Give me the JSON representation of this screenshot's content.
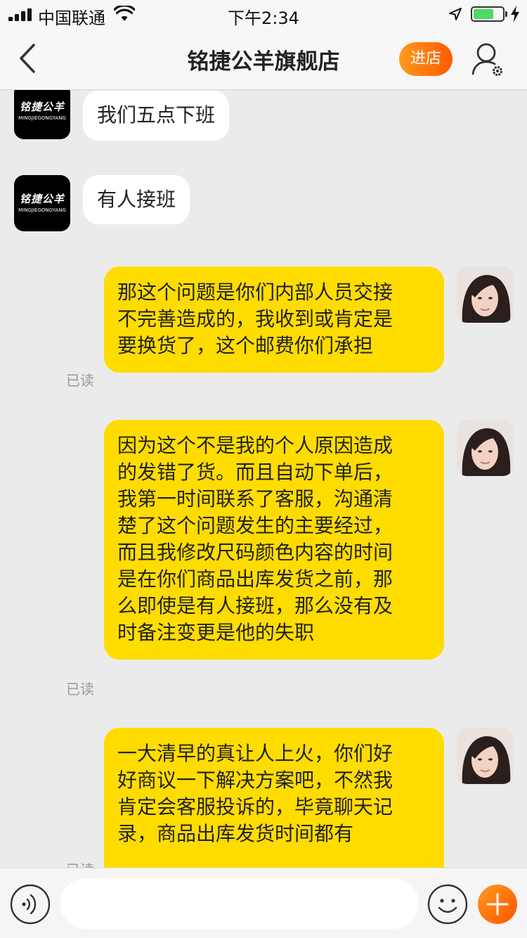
{
  "status_bar": {
    "carrier": "中国联通",
    "time": "下午2:34",
    "battery_level": 0.7,
    "icons": [
      "signal-icon",
      "wifi-icon",
      "location-arrow-icon",
      "battery-icon",
      "charging-bolt-icon"
    ]
  },
  "nav": {
    "title": "铭捷公羊旗舰店",
    "enter_store_label": "进店",
    "icons": [
      "back-chevron-icon",
      "user-settings-icon"
    ]
  },
  "shop_logo": {
    "name_cn": "铭捷公羊",
    "name_en": "MINGJIEGONGYANG"
  },
  "messages": [
    {
      "sender": "shop",
      "text": "我们五点下班"
    },
    {
      "sender": "shop",
      "text": "有人接班"
    },
    {
      "sender": "user",
      "status": "已读",
      "lines": [
        "那这个问题是你们内部人员交接",
        "不完善造成的，我收到或肯定是",
        "要换货了，这个邮费你们承担"
      ]
    },
    {
      "sender": "user",
      "status": "已读",
      "lines": [
        "因为这个不是我的个人原因造成",
        "的发错了货。而且自动下单后，",
        "我第一时间联系了客服，沟通清",
        "楚了这个问题发生的主要经过，",
        "而且我修改尺码颜色内容的时间",
        "是在你们商品出库发货之前，那",
        "么即使是有人接班，那么没有及",
        "时备注变更是他的失职"
      ]
    },
    {
      "sender": "user",
      "status": "已读",
      "lines": [
        "一大清早的真让人上火，你们好",
        "好商议一下解决方案吧，不然我",
        "肯定会客服投诉的，毕竟聊天记",
        "录，商品出库发货时间都有"
      ]
    }
  ],
  "input_bar": {
    "placeholder": "",
    "icons": [
      "voice-icon",
      "emoji-icon",
      "plus-icon"
    ]
  },
  "colors": {
    "outgoing_bubble": "#ffdc00",
    "incoming_bubble": "#ffffff",
    "accent_orange": "#ff7a00",
    "background": "#ebebeb"
  }
}
